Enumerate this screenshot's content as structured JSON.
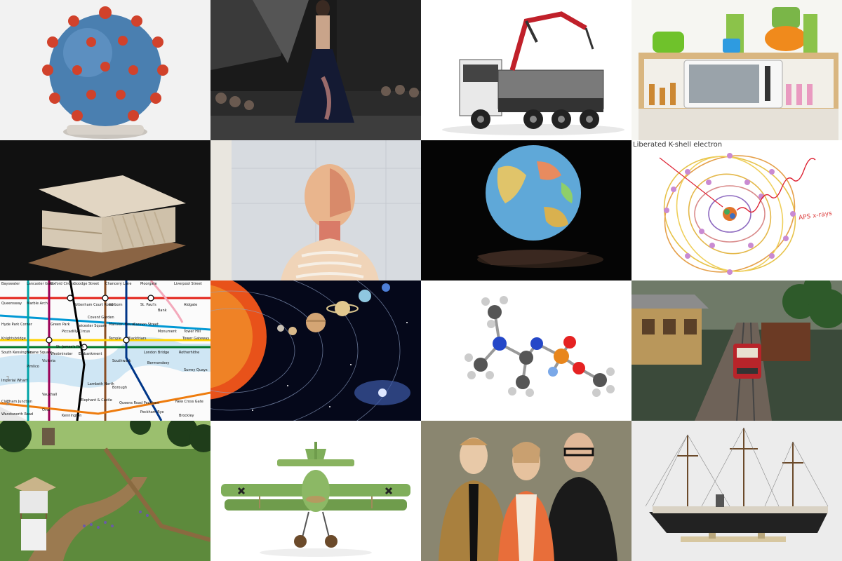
{
  "tiles": [
    {
      "subject": "Coronavirus model on stand",
      "icon": "virus-model"
    },
    {
      "subject": "Fashion runway with model in gown",
      "icon": "runway"
    },
    {
      "subject": "Toy construction truck with crane",
      "icon": "toy-truck"
    },
    {
      "subject": "Toy kitchen with microwave and mixer",
      "icon": "toy-kitchen"
    },
    {
      "subject": "Architectural model of building",
      "icon": "architecture-model"
    },
    {
      "subject": "Anatomical torso model",
      "icon": "anatomy-model"
    },
    {
      "subject": "Globe floating above hand",
      "icon": "globe"
    },
    {
      "subject": "Atom diagram with orbiting electrons",
      "icon": "atom-diagram",
      "labels": {
        "electron": "Liberated K-shell electron",
        "xray": "APS x-rays"
      }
    },
    {
      "subject": "London Underground map section",
      "icon": "tube-map",
      "labels": [
        "Bayswater",
        "Lancaster Gate",
        "Oxford Circus",
        "Goodge Street",
        "Chancery Lane",
        "Moorgate",
        "Liverpool Street",
        "Queensway",
        "Marble Arch",
        "Tottenham Court Road",
        "Holborn",
        "St. Paul's",
        "Bank",
        "Aldgate",
        "Hyde Park Corner",
        "Green Park",
        "Piccadilly Circus",
        "Leicester Square",
        "Covent Garden",
        "Mansion House",
        "Cannon Street",
        "Monument",
        "Tower Hill",
        "Knightsbridge",
        "Westminster",
        "Embankment",
        "Temple",
        "Blackfriars",
        "London Bridge",
        "Tower Gateway",
        "South Kensington",
        "Sloane Square",
        "Victoria",
        "St. James's Park",
        "Southwark",
        "Borough",
        "Bermondsey",
        "Pimlico",
        "Lambeth North",
        "Elephant & Castle",
        "Surrey Quays",
        "Imperial Wharf",
        "Vauxhall",
        "Kennington",
        "Clapham Junction",
        "Queens Road Peckham",
        "Peckham Rye",
        "New Cross Gate",
        "Brockley",
        "Wandsworth Road",
        "Oval",
        "Rotherhithe"
      ],
      "zones": [
        "1",
        "2"
      ]
    },
    {
      "subject": "Solar system planets orbiting the Sun",
      "icon": "solar-system"
    },
    {
      "subject": "Ball-and-stick molecule model",
      "icon": "molecule"
    },
    {
      "subject": "Model railway train at station",
      "icon": "model-train"
    },
    {
      "subject": "Historical diorama with watchtower",
      "icon": "diorama"
    },
    {
      "subject": "Green model biplane",
      "icon": "biplane"
    },
    {
      "subject": "Three fashion mannequins",
      "icon": "mannequins"
    },
    {
      "subject": "Model sailing steamship",
      "icon": "ship-model"
    }
  ]
}
